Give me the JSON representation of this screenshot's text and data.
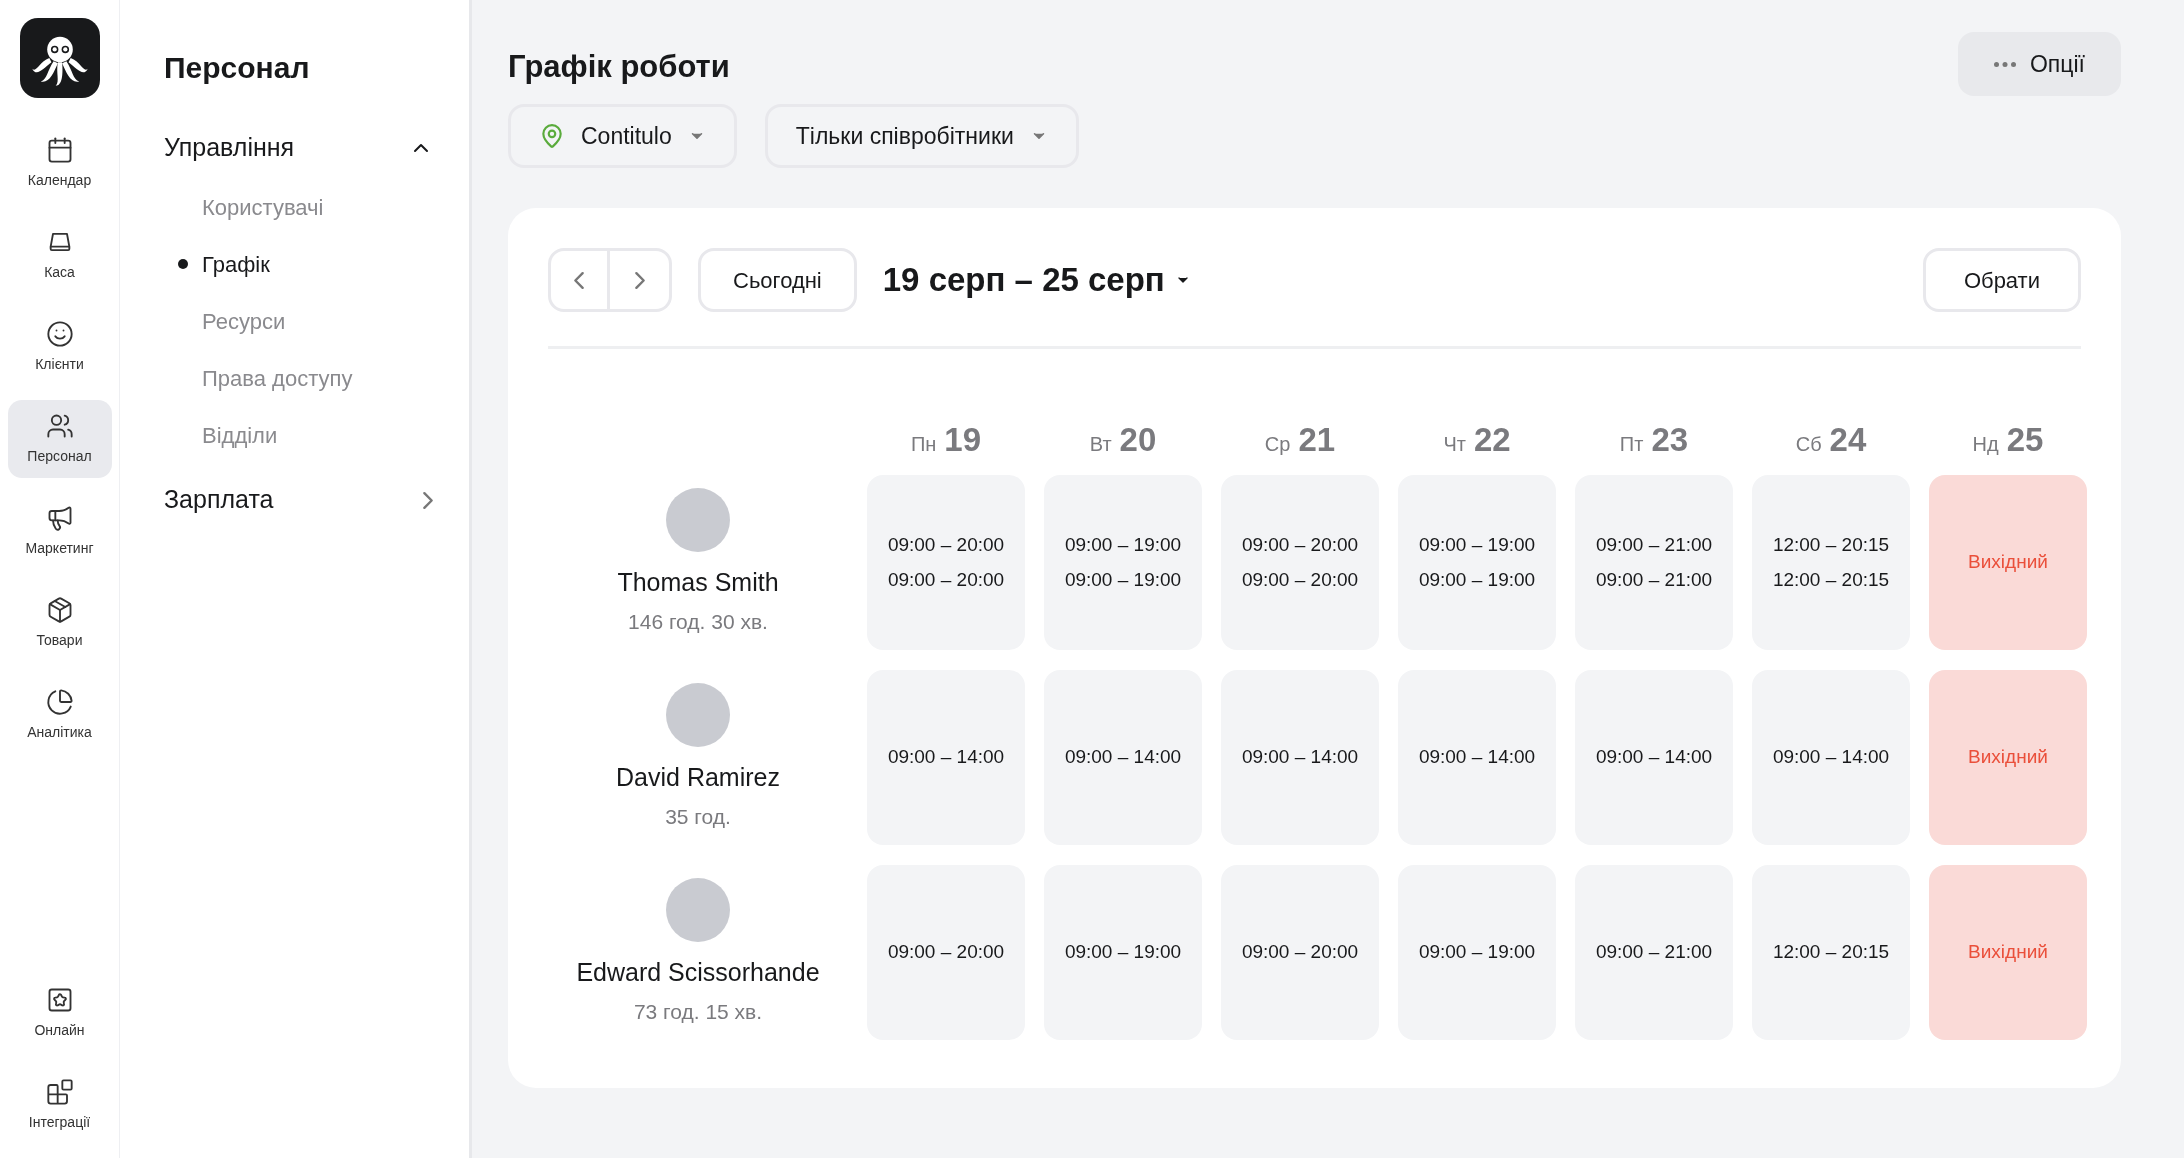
{
  "rail": {
    "items": [
      {
        "label": "Календар",
        "selected": false
      },
      {
        "label": "Каса",
        "selected": false
      },
      {
        "label": "Клієнти",
        "selected": false
      },
      {
        "label": "Персонал",
        "selected": true
      },
      {
        "label": "Маркетинг",
        "selected": false
      },
      {
        "label": "Товари",
        "selected": false
      },
      {
        "label": "Аналітика",
        "selected": false
      }
    ],
    "bottom_items": [
      {
        "label": "Онлайн",
        "selected": false
      },
      {
        "label": "Інтеграції",
        "selected": false
      }
    ]
  },
  "sidebar": {
    "title": "Персонал",
    "sections": [
      {
        "label": "Управління",
        "expanded": true,
        "items": [
          {
            "label": "Користувачі",
            "selected": false
          },
          {
            "label": "Графік",
            "selected": true
          },
          {
            "label": "Ресурси",
            "selected": false
          },
          {
            "label": "Права доступу",
            "selected": false
          },
          {
            "label": "Відділи",
            "selected": false
          }
        ]
      },
      {
        "label": "Зарплата",
        "expanded": false
      }
    ]
  },
  "page": {
    "title": "Графік роботи",
    "options_button": "Опції",
    "filters": [
      {
        "label": "Contitulo",
        "kind": "location"
      },
      {
        "label": "Тільки співробітники",
        "kind": "plain"
      }
    ]
  },
  "schedule": {
    "today_button": "Сьогодні",
    "range": "19 серп – 25 серп",
    "select_button": "Обрати",
    "days": [
      {
        "weekday": "Пн",
        "date": "19"
      },
      {
        "weekday": "Вт",
        "date": "20"
      },
      {
        "weekday": "Ср",
        "date": "21"
      },
      {
        "weekday": "Чт",
        "date": "22"
      },
      {
        "weekday": "Пт",
        "date": "23"
      },
      {
        "weekday": "Сб",
        "date": "24"
      },
      {
        "weekday": "Нд",
        "date": "25"
      }
    ],
    "staff": [
      {
        "name": "Thomas Smith",
        "hours": "146 год. 30 хв.",
        "cells": [
          {
            "kind": "shift",
            "lines": [
              "09:00 – 20:00",
              "09:00 – 20:00"
            ]
          },
          {
            "kind": "shift",
            "lines": [
              "09:00 – 19:00",
              "09:00 – 19:00"
            ]
          },
          {
            "kind": "shift",
            "lines": [
              "09:00 – 20:00",
              "09:00 – 20:00"
            ]
          },
          {
            "kind": "shift",
            "lines": [
              "09:00 – 19:00",
              "09:00 – 19:00"
            ]
          },
          {
            "kind": "shift",
            "lines": [
              "09:00 – 21:00",
              "09:00 – 21:00"
            ]
          },
          {
            "kind": "shift",
            "lines": [
              "12:00 – 20:15",
              "12:00 – 20:15"
            ]
          },
          {
            "kind": "off",
            "lines": [
              "Вихідний"
            ]
          }
        ]
      },
      {
        "name": "David Ramirez",
        "hours": "35 год.",
        "cells": [
          {
            "kind": "shift",
            "lines": [
              "09:00 – 14:00"
            ]
          },
          {
            "kind": "shift",
            "lines": [
              "09:00 – 14:00"
            ]
          },
          {
            "kind": "shift",
            "lines": [
              "09:00 – 14:00"
            ]
          },
          {
            "kind": "shift",
            "lines": [
              "09:00 – 14:00"
            ]
          },
          {
            "kind": "shift",
            "lines": [
              "09:00 – 14:00"
            ]
          },
          {
            "kind": "shift",
            "lines": [
              "09:00 – 14:00"
            ]
          },
          {
            "kind": "off",
            "lines": [
              "Вихідний"
            ]
          }
        ]
      },
      {
        "name": "Edward Scissorhande",
        "hours": "73 год. 15 хв.",
        "cells": [
          {
            "kind": "shift",
            "lines": [
              "09:00 – 20:00"
            ]
          },
          {
            "kind": "shift",
            "lines": [
              "09:00 – 19:00"
            ]
          },
          {
            "kind": "shift",
            "lines": [
              "09:00 – 20:00"
            ]
          },
          {
            "kind": "shift",
            "lines": [
              "09:00 – 19:00"
            ]
          },
          {
            "kind": "shift",
            "lines": [
              "09:00 – 21:00"
            ]
          },
          {
            "kind": "shift",
            "lines": [
              "12:00 – 20:15"
            ]
          },
          {
            "kind": "off",
            "lines": [
              "Вихідний"
            ]
          }
        ]
      }
    ]
  }
}
